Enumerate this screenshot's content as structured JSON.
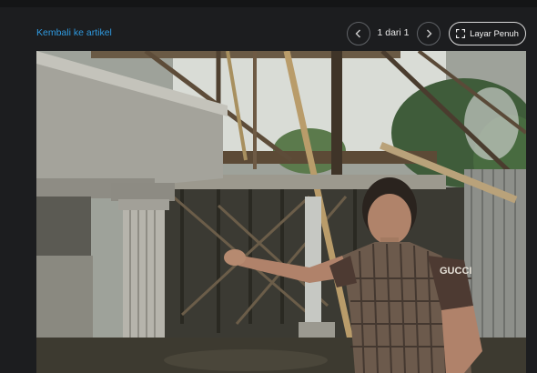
{
  "header": {
    "back_label": "Kembali ke artikel",
    "page_counter": "1 dari 1",
    "fullscreen_label": "Layar Penuh"
  },
  "icons": {
    "prev": "chevron-left-icon",
    "next": "chevron-right-icon",
    "fullscreen": "fullscreen-icon"
  },
  "photo": {
    "shirt_text": "GUCCI"
  },
  "colors": {
    "background": "#1c1d1f",
    "link": "#2f9ae0",
    "text": "#e8e8e8"
  }
}
